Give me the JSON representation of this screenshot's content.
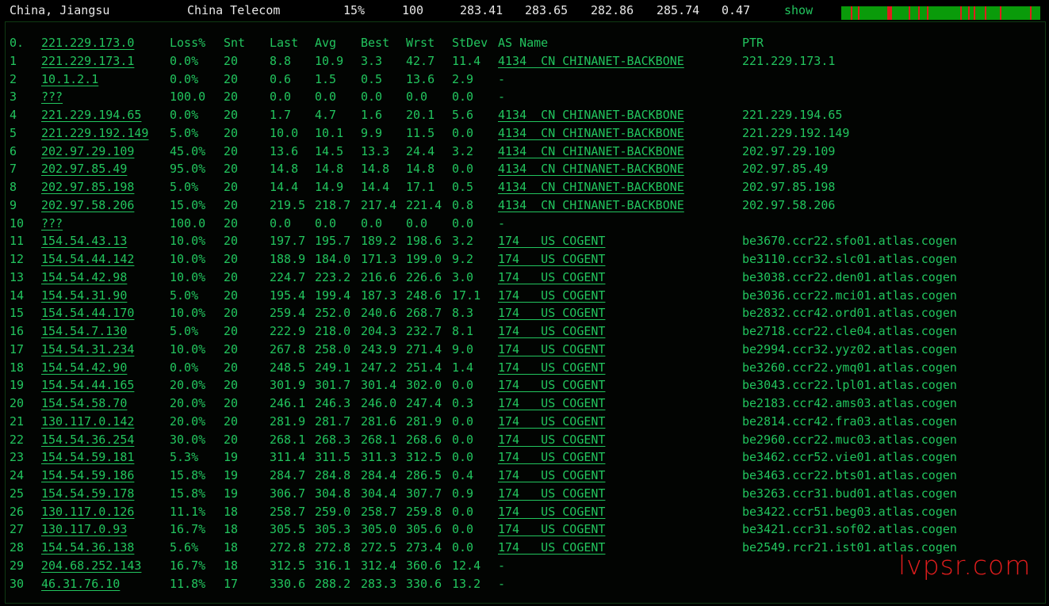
{
  "topbar": {
    "location": "China, Jiangsu",
    "isp": "China Telecom",
    "loss": "15%",
    "sent": "100",
    "last": "283.41",
    "avg": "283.65",
    "best": "282.86",
    "worst": "285.74",
    "stdev": "0.47",
    "show_label": "show"
  },
  "colors": {
    "text": "#22c55e",
    "bar_ok": "#0a9b0a",
    "bar_loss": "#e11d1d",
    "watermark": "#e11d1d"
  },
  "header": {
    "idx": "0.",
    "ip": "221.229.173.0",
    "loss": "Loss%",
    "snt": "Snt",
    "last": "Last",
    "avg": "Avg",
    "best": "Best",
    "wrst": "Wrst",
    "stdev": "StDev",
    "as": "AS Name",
    "ptr": "PTR"
  },
  "hops": [
    {
      "idx": "1",
      "ip": "221.229.173.1",
      "loss": "0.0%",
      "snt": "20",
      "last": "8.8",
      "avg": "10.9",
      "best": "3.3",
      "wrst": "42.7",
      "stdev": "11.4",
      "as": "4134  CN CHINANET-BACKBONE",
      "ptr": "221.229.173.1"
    },
    {
      "idx": "2",
      "ip": "10.1.2.1",
      "loss": "0.0%",
      "snt": "20",
      "last": "0.6",
      "avg": "1.5",
      "best": "0.5",
      "wrst": "13.6",
      "stdev": "2.9",
      "as": "-",
      "ptr": ""
    },
    {
      "idx": "3",
      "ip": "???",
      "loss": "100.0",
      "snt": "20",
      "last": "0.0",
      "avg": "0.0",
      "best": "0.0",
      "wrst": "0.0",
      "stdev": "0.0",
      "as": "-",
      "ptr": ""
    },
    {
      "idx": "4",
      "ip": "221.229.194.65",
      "loss": "0.0%",
      "snt": "20",
      "last": "1.7",
      "avg": "4.7",
      "best": "1.6",
      "wrst": "20.1",
      "stdev": "5.6",
      "as": "4134  CN CHINANET-BACKBONE",
      "ptr": "221.229.194.65"
    },
    {
      "idx": "5",
      "ip": "221.229.192.149",
      "loss": "5.0%",
      "snt": "20",
      "last": "10.0",
      "avg": "10.1",
      "best": "9.9",
      "wrst": "11.5",
      "stdev": "0.0",
      "as": "4134  CN CHINANET-BACKBONE",
      "ptr": "221.229.192.149"
    },
    {
      "idx": "6",
      "ip": "202.97.29.109",
      "loss": "45.0%",
      "snt": "20",
      "last": "13.6",
      "avg": "14.5",
      "best": "13.3",
      "wrst": "24.4",
      "stdev": "3.2",
      "as": "4134  CN CHINANET-BACKBONE",
      "ptr": "202.97.29.109"
    },
    {
      "idx": "7",
      "ip": "202.97.85.49",
      "loss": "95.0%",
      "snt": "20",
      "last": "14.8",
      "avg": "14.8",
      "best": "14.8",
      "wrst": "14.8",
      "stdev": "0.0",
      "as": "4134  CN CHINANET-BACKBONE",
      "ptr": "202.97.85.49"
    },
    {
      "idx": "8",
      "ip": "202.97.85.198",
      "loss": "5.0%",
      "snt": "20",
      "last": "14.4",
      "avg": "14.9",
      "best": "14.4",
      "wrst": "17.1",
      "stdev": "0.5",
      "as": "4134  CN CHINANET-BACKBONE",
      "ptr": "202.97.85.198"
    },
    {
      "idx": "9",
      "ip": "202.97.58.206",
      "loss": "15.0%",
      "snt": "20",
      "last": "219.5",
      "avg": "218.7",
      "best": "217.4",
      "wrst": "221.4",
      "stdev": "0.8",
      "as": "4134  CN CHINANET-BACKBONE",
      "ptr": "202.97.58.206"
    },
    {
      "idx": "10",
      "ip": "???",
      "loss": "100.0",
      "snt": "20",
      "last": "0.0",
      "avg": "0.0",
      "best": "0.0",
      "wrst": "0.0",
      "stdev": "0.0",
      "as": "-",
      "ptr": ""
    },
    {
      "idx": "11",
      "ip": "154.54.43.13",
      "loss": "10.0%",
      "snt": "20",
      "last": "197.7",
      "avg": "195.7",
      "best": "189.2",
      "wrst": "198.6",
      "stdev": "3.2",
      "as": "174   US COGENT",
      "ptr": "be3670.ccr22.sfo01.atlas.cogen"
    },
    {
      "idx": "12",
      "ip": "154.54.44.142",
      "loss": "10.0%",
      "snt": "20",
      "last": "188.9",
      "avg": "184.0",
      "best": "171.3",
      "wrst": "199.0",
      "stdev": "9.2",
      "as": "174   US COGENT",
      "ptr": "be3110.ccr32.slc01.atlas.cogen"
    },
    {
      "idx": "13",
      "ip": "154.54.42.98",
      "loss": "10.0%",
      "snt": "20",
      "last": "224.7",
      "avg": "223.2",
      "best": "216.6",
      "wrst": "226.6",
      "stdev": "3.0",
      "as": "174   US COGENT",
      "ptr": "be3038.ccr22.den01.atlas.cogen"
    },
    {
      "idx": "14",
      "ip": "154.54.31.90",
      "loss": "5.0%",
      "snt": "20",
      "last": "195.4",
      "avg": "199.4",
      "best": "187.3",
      "wrst": "248.6",
      "stdev": "17.1",
      "as": "174   US COGENT",
      "ptr": "be3036.ccr22.mci01.atlas.cogen"
    },
    {
      "idx": "15",
      "ip": "154.54.44.170",
      "loss": "10.0%",
      "snt": "20",
      "last": "259.4",
      "avg": "252.0",
      "best": "240.6",
      "wrst": "268.7",
      "stdev": "8.3",
      "as": "174   US COGENT",
      "ptr": "be2832.ccr42.ord01.atlas.cogen"
    },
    {
      "idx": "16",
      "ip": "154.54.7.130",
      "loss": "5.0%",
      "snt": "20",
      "last": "222.9",
      "avg": "218.0",
      "best": "204.3",
      "wrst": "232.7",
      "stdev": "8.1",
      "as": "174   US COGENT",
      "ptr": "be2718.ccr22.cle04.atlas.cogen"
    },
    {
      "idx": "17",
      "ip": "154.54.31.234",
      "loss": "10.0%",
      "snt": "20",
      "last": "267.8",
      "avg": "258.0",
      "best": "243.9",
      "wrst": "271.4",
      "stdev": "9.0",
      "as": "174   US COGENT",
      "ptr": "be2994.ccr32.yyz02.atlas.cogen"
    },
    {
      "idx": "18",
      "ip": "154.54.42.90",
      "loss": "0.0%",
      "snt": "20",
      "last": "248.5",
      "avg": "249.1",
      "best": "247.2",
      "wrst": "251.4",
      "stdev": "1.4",
      "as": "174   US COGENT",
      "ptr": "be3260.ccr22.ymq01.atlas.cogen"
    },
    {
      "idx": "19",
      "ip": "154.54.44.165",
      "loss": "20.0%",
      "snt": "20",
      "last": "301.9",
      "avg": "301.7",
      "best": "301.4",
      "wrst": "302.0",
      "stdev": "0.0",
      "as": "174   US COGENT",
      "ptr": "be3043.ccr22.lpl01.atlas.cogen"
    },
    {
      "idx": "20",
      "ip": "154.54.58.70",
      "loss": "20.0%",
      "snt": "20",
      "last": "246.1",
      "avg": "246.3",
      "best": "246.0",
      "wrst": "247.4",
      "stdev": "0.3",
      "as": "174   US COGENT",
      "ptr": "be2183.ccr42.ams03.atlas.cogen"
    },
    {
      "idx": "21",
      "ip": "130.117.0.142",
      "loss": "20.0%",
      "snt": "20",
      "last": "281.9",
      "avg": "281.7",
      "best": "281.6",
      "wrst": "281.9",
      "stdev": "0.0",
      "as": "174   US COGENT",
      "ptr": "be2814.ccr42.fra03.atlas.cogen"
    },
    {
      "idx": "22",
      "ip": "154.54.36.254",
      "loss": "30.0%",
      "snt": "20",
      "last": "268.1",
      "avg": "268.3",
      "best": "268.1",
      "wrst": "268.6",
      "stdev": "0.0",
      "as": "174   US COGENT",
      "ptr": "be2960.ccr22.muc03.atlas.cogen"
    },
    {
      "idx": "23",
      "ip": "154.54.59.181",
      "loss": "5.3%",
      "snt": "19",
      "last": "311.4",
      "avg": "311.5",
      "best": "311.3",
      "wrst": "312.5",
      "stdev": "0.0",
      "as": "174   US COGENT",
      "ptr": "be3462.ccr52.vie01.atlas.cogen"
    },
    {
      "idx": "24",
      "ip": "154.54.59.186",
      "loss": "15.8%",
      "snt": "19",
      "last": "284.7",
      "avg": "284.8",
      "best": "284.4",
      "wrst": "286.5",
      "stdev": "0.4",
      "as": "174   US COGENT",
      "ptr": "be3463.ccr22.bts01.atlas.cogen"
    },
    {
      "idx": "25",
      "ip": "154.54.59.178",
      "loss": "15.8%",
      "snt": "19",
      "last": "306.7",
      "avg": "304.8",
      "best": "304.4",
      "wrst": "307.7",
      "stdev": "0.9",
      "as": "174   US COGENT",
      "ptr": "be3263.ccr31.bud01.atlas.cogen"
    },
    {
      "idx": "26",
      "ip": "130.117.0.126",
      "loss": "11.1%",
      "snt": "18",
      "last": "258.7",
      "avg": "259.0",
      "best": "258.7",
      "wrst": "259.8",
      "stdev": "0.0",
      "as": "174   US COGENT",
      "ptr": "be3422.ccr51.beg03.atlas.cogen"
    },
    {
      "idx": "27",
      "ip": "130.117.0.93",
      "loss": "16.7%",
      "snt": "18",
      "last": "305.5",
      "avg": "305.3",
      "best": "305.0",
      "wrst": "305.6",
      "stdev": "0.0",
      "as": "174   US COGENT",
      "ptr": "be3421.ccr31.sof02.atlas.cogen"
    },
    {
      "idx": "28",
      "ip": "154.54.36.138",
      "loss": "5.6%",
      "snt": "18",
      "last": "272.8",
      "avg": "272.8",
      "best": "272.5",
      "wrst": "273.4",
      "stdev": "0.0",
      "as": "174   US COGENT",
      "ptr": "be2549.rcr21.ist01.atlas.cogen"
    },
    {
      "idx": "29",
      "ip": "204.68.252.143",
      "loss": "16.7%",
      "snt": "18",
      "last": "312.5",
      "avg": "316.1",
      "best": "312.4",
      "wrst": "360.6",
      "stdev": "12.4",
      "as": "-",
      "ptr": ""
    },
    {
      "idx": "30",
      "ip": "46.31.76.10",
      "loss": "11.8%",
      "snt": "17",
      "last": "330.6",
      "avg": "288.2",
      "best": "283.3",
      "wrst": "330.6",
      "stdev": "13.2",
      "as": "-",
      "ptr": ""
    }
  ],
  "watermark": "lvpsr.com"
}
